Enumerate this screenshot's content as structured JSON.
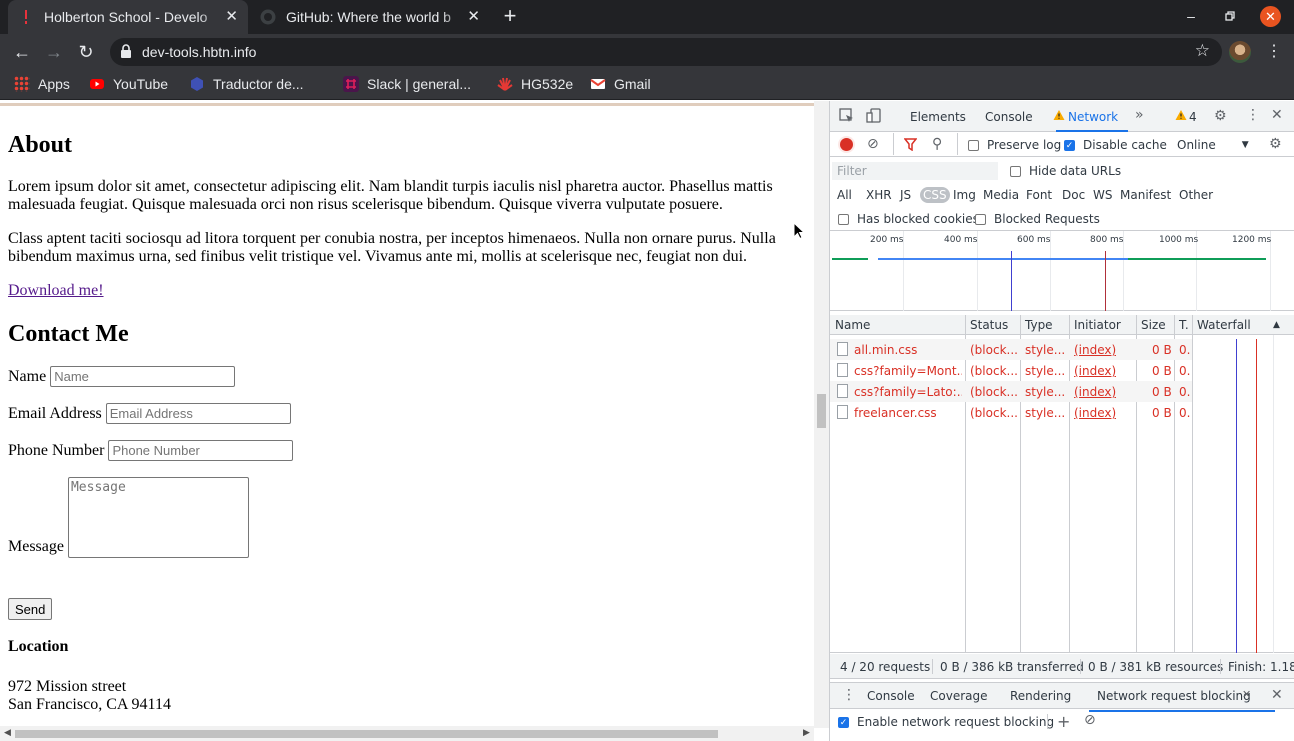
{
  "browser": {
    "tabs": [
      {
        "title": "Holberton School - Develo",
        "active": true
      },
      {
        "title": "GitHub: Where the world b",
        "active": false
      }
    ],
    "url": "dev-tools.hbtn.info",
    "bookmarks": [
      {
        "label": "Apps",
        "icon": "apps-grid-icon"
      },
      {
        "label": "YouTube",
        "icon": "youtube-icon"
      },
      {
        "label": "Traductor de...",
        "icon": "translate-icon"
      },
      {
        "label": "Slack | general...",
        "icon": "slack-icon"
      },
      {
        "label": "HG532e",
        "icon": "huawei-icon"
      },
      {
        "label": "Gmail",
        "icon": "gmail-icon"
      }
    ]
  },
  "page": {
    "about_heading": "About",
    "about_p1": "Lorem ipsum dolor sit amet, consectetur adipiscing elit. Nam blandit turpis iaculis nisl pharetra auctor. Phasellus mattis malesuada feugiat. Quisque malesuada orci non risus scelerisque bibendum. Quisque viverra vulputate posuere.",
    "about_p2": "Class aptent taciti sociosqu ad litora torquent per conubia nostra, per inceptos himenaeos. Nulla non ornare purus. Nulla bibendum maximus urna, sed finibus velit tristique vel. Vivamus ante mi, mollis at scelerisque nec, feugiat non dui.",
    "download_link": "Download me!",
    "contact_heading": "Contact Me",
    "form": {
      "name_label": "Name",
      "name_placeholder": "Name",
      "email_label": "Email Address",
      "email_placeholder": "Email Address",
      "phone_label": "Phone Number",
      "phone_placeholder": "Phone Number",
      "message_label": "Message",
      "message_placeholder": "Message",
      "send_label": "Send"
    },
    "location_heading": "Location",
    "address_line1": "972 Mission street",
    "address_line2": "San Francisco, CA 94114"
  },
  "devtools": {
    "tabs": [
      "Elements",
      "Console",
      "Network"
    ],
    "active_tab": "Network",
    "warning_count": "4",
    "toolbar": {
      "preserve_log": "Preserve log",
      "disable_cache": "Disable cache",
      "throttle": "Online"
    },
    "filter_placeholder": "Filter",
    "hide_data_urls": "Hide data URLs",
    "type_filters": [
      "All",
      "XHR",
      "JS",
      "CSS",
      "Img",
      "Media",
      "Font",
      "Doc",
      "WS",
      "Manifest",
      "Other"
    ],
    "selected_type": "CSS",
    "has_blocked_cookies": "Has blocked cookies",
    "blocked_requests": "Blocked Requests",
    "overview_ticks": [
      "200 ms",
      "400 ms",
      "600 ms",
      "800 ms",
      "1000 ms",
      "1200 ms"
    ],
    "columns": [
      "Name",
      "Status",
      "Type",
      "Initiator",
      "Size",
      "T.",
      "Waterfall"
    ],
    "requests": [
      {
        "name": "all.min.css",
        "status": "(block...",
        "type": "style...",
        "initiator": "(index)",
        "size": "0 B",
        "time": "0..."
      },
      {
        "name": "css?family=Mont...",
        "status": "(block...",
        "type": "style...",
        "initiator": "(index)",
        "size": "0 B",
        "time": "0..."
      },
      {
        "name": "css?family=Lato:...",
        "status": "(block...",
        "type": "style...",
        "initiator": "(index)",
        "size": "0 B",
        "time": "0..."
      },
      {
        "name": "freelancer.css",
        "status": "(block...",
        "type": "style...",
        "initiator": "(index)",
        "size": "0 B",
        "time": "0..."
      }
    ],
    "summary": {
      "requests": "4 / 20 requests",
      "transferred": "0 B / 386 kB transferred",
      "resources": "0 B / 381 kB resources",
      "finish": "Finish: 1.18"
    },
    "drawer_tabs": [
      "Console",
      "Coverage",
      "Rendering",
      "Network request blocking"
    ],
    "drawer_active": "Network request blocking",
    "enable_blocking": "Enable network request blocking"
  },
  "colors": {
    "accent": "#1a73e8",
    "error": "#d93025",
    "chrome_dark": "#202124"
  }
}
